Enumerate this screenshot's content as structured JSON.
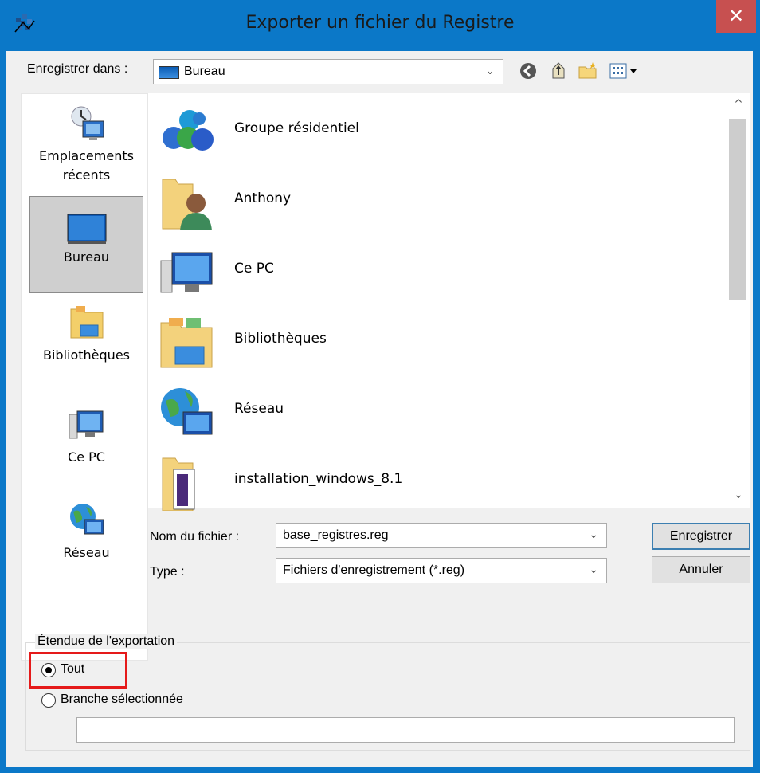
{
  "window": {
    "title": "Exporter un fichier du Registre",
    "close_symbol": "✕"
  },
  "lookin": {
    "label": "Enregistrer dans :",
    "value": "Bureau",
    "chevron": "⌄"
  },
  "places": [
    {
      "label": "Emplacements récents",
      "icon": "recent-places-icon"
    },
    {
      "label": "Bureau",
      "icon": "desktop-icon",
      "selected": true
    },
    {
      "label": "Bibliothèques",
      "icon": "libraries-icon"
    },
    {
      "label": "Ce PC",
      "icon": "computer-icon"
    },
    {
      "label": "Réseau",
      "icon": "network-icon"
    }
  ],
  "files": [
    {
      "name": "Groupe résidentiel",
      "icon": "homegroup-icon"
    },
    {
      "name": "Anthony",
      "icon": "user-folder-icon"
    },
    {
      "name": "Ce PC",
      "icon": "computer-icon"
    },
    {
      "name": "Bibliothèques",
      "icon": "libraries-icon"
    },
    {
      "name": "Réseau",
      "icon": "network-icon"
    },
    {
      "name": "installation_windows_8.1",
      "icon": "folder-icon"
    }
  ],
  "filename": {
    "label": "Nom du fichier :",
    "value": "base_registres.reg"
  },
  "filetype": {
    "label": "Type :",
    "value": "Fichiers d'enregistrement (*.reg)"
  },
  "buttons": {
    "save": "Enregistrer",
    "cancel": "Annuler"
  },
  "export_range": {
    "title": "Étendue de l'exportation",
    "option_all": "Tout",
    "option_branch": "Branche sélectionnée",
    "selected": "all",
    "branch_value": ""
  },
  "colors": {
    "title_bar": "#0b78c8",
    "close_button": "#c75050",
    "highlight": "#e51a1a"
  }
}
